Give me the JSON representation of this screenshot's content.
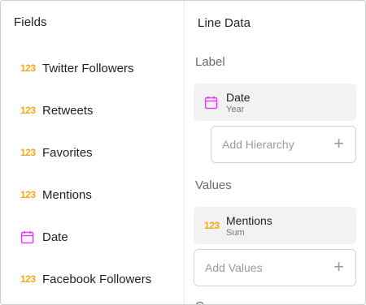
{
  "fields_panel": {
    "title": "Fields",
    "items": [
      {
        "icon": "number-icon",
        "icon_text": "123",
        "label": "Twitter Followers"
      },
      {
        "icon": "number-icon",
        "icon_text": "123",
        "label": "Retweets"
      },
      {
        "icon": "number-icon",
        "icon_text": "123",
        "label": "Favorites"
      },
      {
        "icon": "number-icon",
        "icon_text": "123",
        "label": "Mentions"
      },
      {
        "icon": "calendar-icon",
        "icon_text": "",
        "label": "Date"
      },
      {
        "icon": "number-icon",
        "icon_text": "123",
        "label": "Facebook Followers"
      }
    ]
  },
  "line_data_panel": {
    "title": "Line Data",
    "label_section": {
      "heading": "Label",
      "chip": {
        "icon": "calendar-icon",
        "title": "Date",
        "subtitle": "Year"
      },
      "dropzone": {
        "label": "Add Hierarchy",
        "plus": "+"
      }
    },
    "values_section": {
      "heading": "Values",
      "chip": {
        "icon": "number-icon",
        "icon_text": "123",
        "title": "Mentions",
        "subtitle": "Sum"
      },
      "dropzone": {
        "label": "Add Values",
        "plus": "+"
      }
    },
    "next_section_partial": "C"
  },
  "colors": {
    "number_icon": "#f5a623",
    "calendar_icon": "#e040fb",
    "chip_bg": "#f2f2f2"
  }
}
